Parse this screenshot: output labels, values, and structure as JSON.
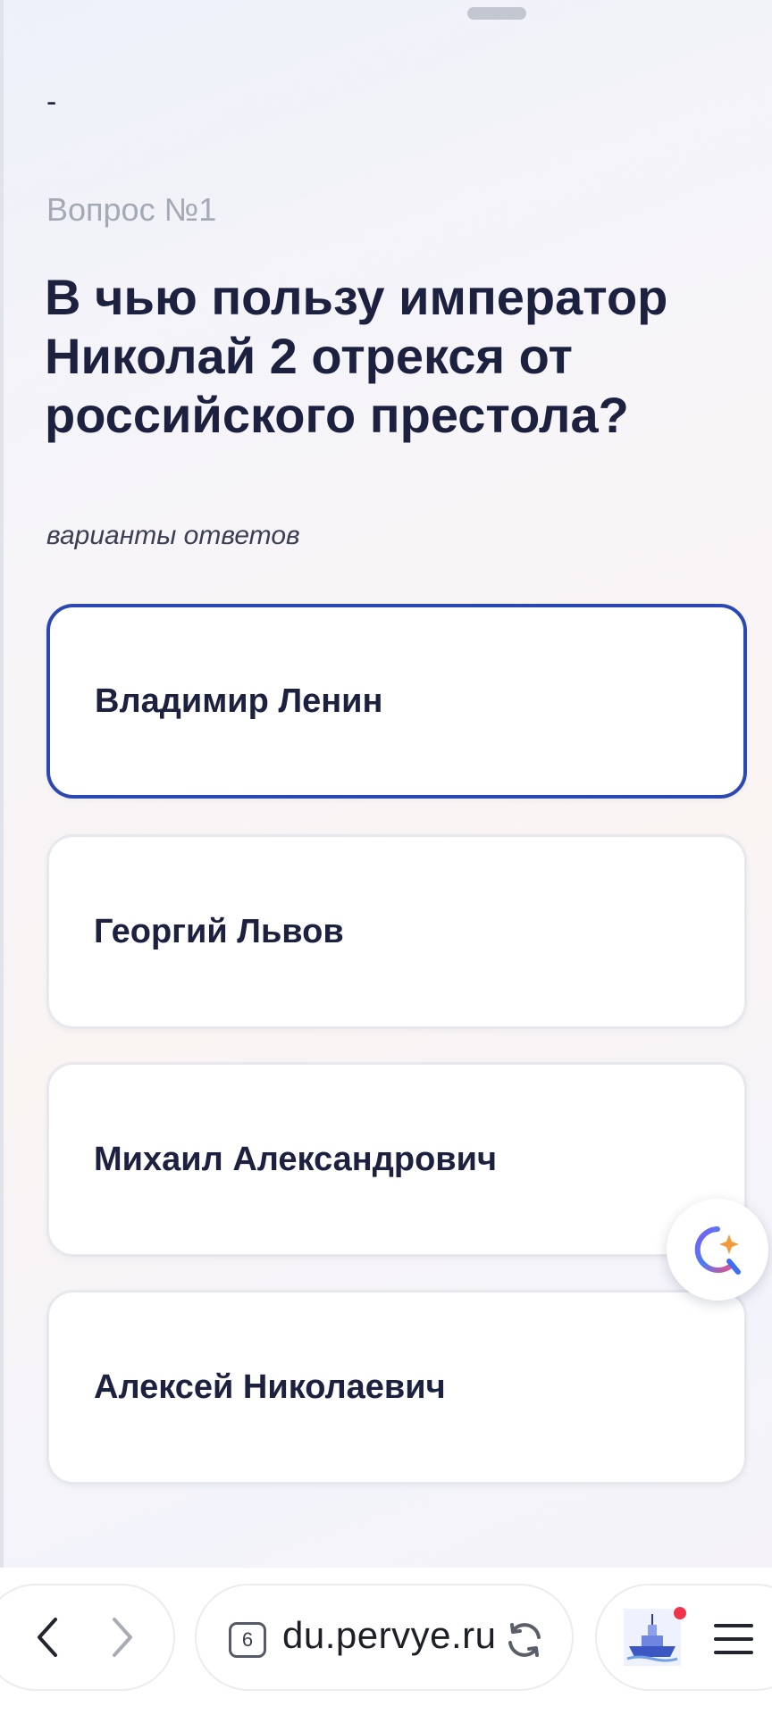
{
  "page": {
    "dash": "-",
    "question_number": "Вопрос №1",
    "question_title": "В чью пользу император Николай 2 отрекся от российского престола?",
    "answers_label": "варианты ответов"
  },
  "answers": [
    {
      "label": "Владимир Ленин",
      "selected": true
    },
    {
      "label": "Георгий Львов",
      "selected": false
    },
    {
      "label": "Михаил Александрович",
      "selected": false
    },
    {
      "label": "Алексей Николаевич",
      "selected": false
    }
  ],
  "browser": {
    "tab_count": "6",
    "url": "du.pervye.ru",
    "icons": [
      "back-arrow-icon",
      "forward-arrow-icon",
      "reload-icon",
      "ship-avatar-icon",
      "menu-icon"
    ]
  },
  "colors": {
    "accent": "#2a48b4",
    "text": "#1c2140",
    "muted": "#a4a9b6",
    "notification": "#f0344a"
  }
}
